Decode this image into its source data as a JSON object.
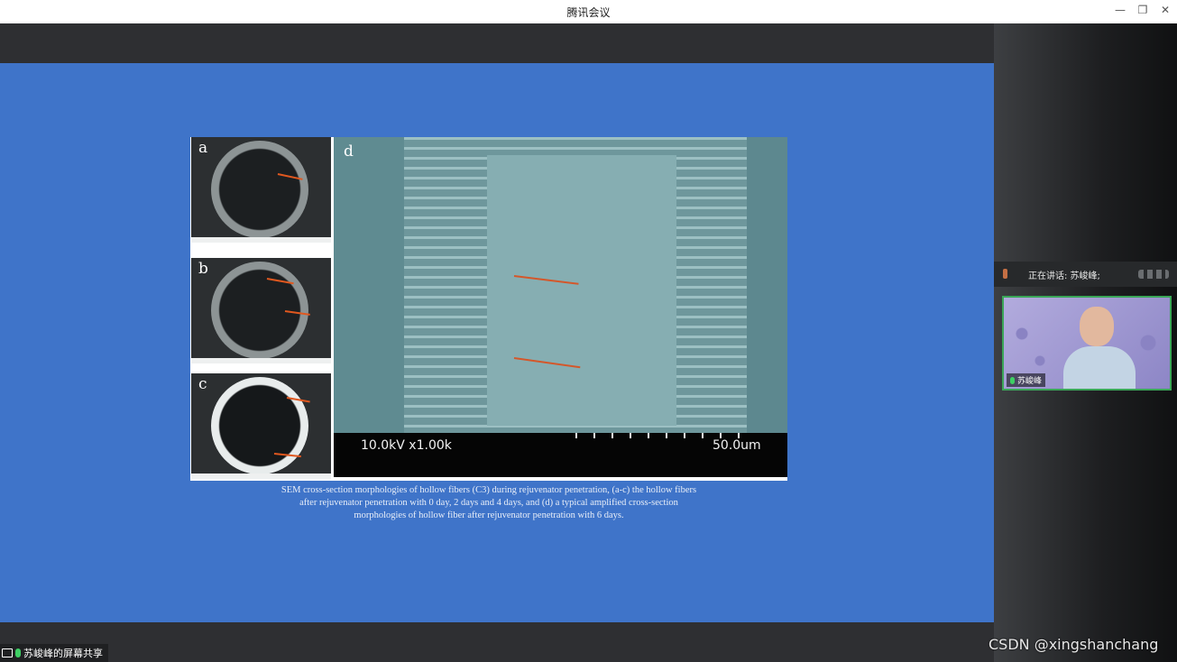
{
  "window": {
    "title": "腾讯会议",
    "controls": {
      "minimize": "—",
      "restore": "❐",
      "close": "✕"
    }
  },
  "slide": {
    "figure": {
      "panels": [
        "a",
        "b",
        "c",
        "d"
      ],
      "sem_info_left": "10.0kV x1.00k",
      "sem_info_right": "50.0um"
    },
    "caption": [
      "SEM cross-section morphologies of hollow fibers (C3) during rejuvenator penetration, (a-c) the hollow fibers",
      "after rejuvenator penetration with 0 day, 2 days and 4 days, and (d) a typical amplified cross-section",
      "morphologies of hollow fiber after rejuvenator penetration with 6 days."
    ]
  },
  "share_badge": {
    "label": "苏峻峰的屏幕共享"
  },
  "speaking": {
    "label": "正在讲话: 苏峻峰;"
  },
  "video": {
    "participant_name": "苏峻峰"
  },
  "watermark": "CSDN @xingshanchang",
  "colors": {
    "slide_bg": "#3f74c9",
    "active_speaker_border": "#3aa657"
  }
}
